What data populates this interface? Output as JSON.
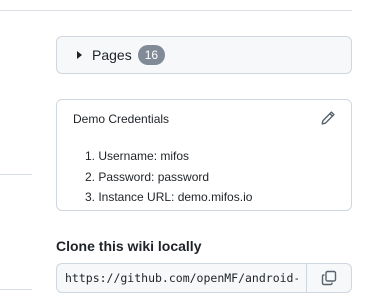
{
  "pages": {
    "label": "Pages",
    "count": "16"
  },
  "credentials": {
    "title": "Demo Credentials",
    "items": [
      "1. Username: mifos",
      "2. Password: password",
      "3. Instance URL: demo.mifos.io"
    ]
  },
  "clone": {
    "title": "Clone this wiki locally",
    "url": "https://github.com/openMF/android-client.wiki.git"
  },
  "icons": {
    "caret": "triangle-right-icon",
    "edit": "pencil-icon",
    "copy": "copy-icon"
  },
  "colors": {
    "border": "#d0d7de",
    "box_bg": "#f6f8fa",
    "counter_bg": "#818b98",
    "text": "#1f2328"
  }
}
